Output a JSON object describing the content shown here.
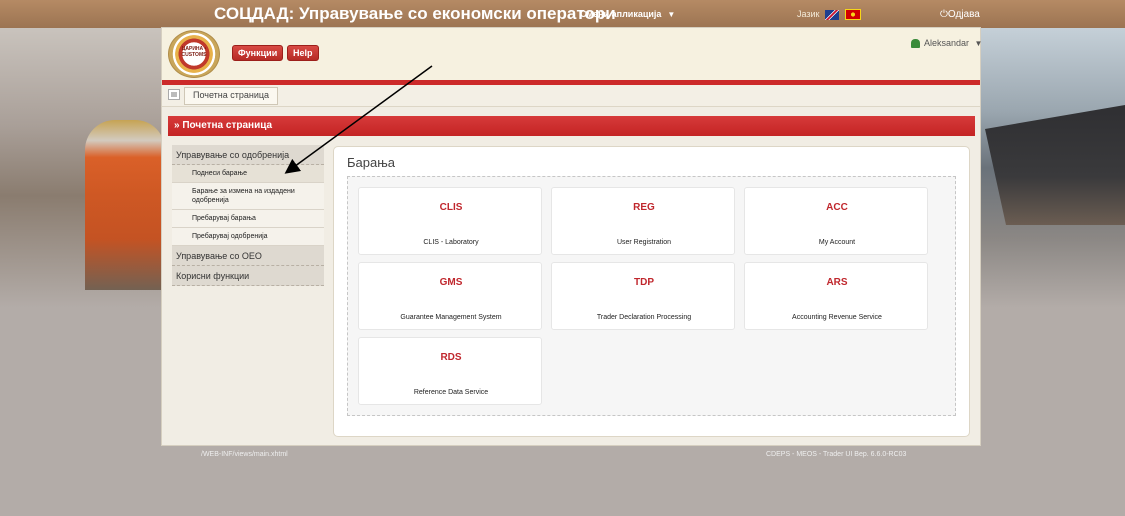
{
  "topbar": {
    "title": "СОЦДАД: Управување со економски оператори",
    "switch_app": "Смени апликација",
    "language": "Јазик",
    "logout": "Одјава"
  },
  "header": {
    "logo_text": "ЦАРИНА • CUSTOMS",
    "functions_button": "Функции",
    "help_button": "Help",
    "user": "Aleksandar"
  },
  "breadcrumb": "Почетна страница",
  "section_title": "» Почетна страница",
  "nav": {
    "groups": [
      {
        "label": "Управување со одобренија"
      },
      {
        "label": "Управување со ОЕО"
      },
      {
        "label": "Корисни функции"
      }
    ],
    "subitems": [
      "Поднеси барање",
      "Барање за измена на издадени одобренија",
      "Пребарувај барања",
      "Пребарувај одобренија"
    ]
  },
  "panel_title": "Барања",
  "tiles": [
    {
      "code": "CLIS",
      "name": "CLIS - Laboratory"
    },
    {
      "code": "REG",
      "name": "User Registration"
    },
    {
      "code": "ACC",
      "name": "My Account"
    },
    {
      "code": "GMS",
      "name": "Guarantee Management System"
    },
    {
      "code": "TDP",
      "name": "Trader Declaration Processing"
    },
    {
      "code": "ARS",
      "name": "Accounting Revenue Service"
    },
    {
      "code": "RDS",
      "name": "Reference Data Service"
    }
  ],
  "footer": {
    "left": "/WEB-INF/views/main.xhtml",
    "right": "CDEPS - MEOS - Trader UI Вер. 6.6.0-RC03"
  },
  "colors": {
    "accent_red": "#c0272d",
    "topbar_brown": "#a57c58"
  }
}
